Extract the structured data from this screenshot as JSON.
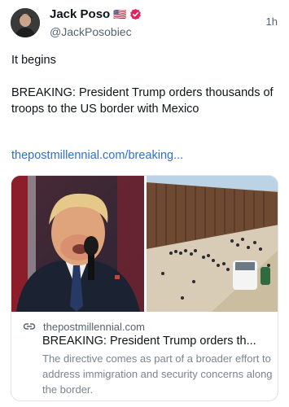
{
  "author": {
    "display_name": "Jack Poso",
    "flag": "🇺🇸",
    "handle": "@JackPosobiec",
    "verified": true,
    "avatar_icon": "person-avatar"
  },
  "timestamp": "1h",
  "post": {
    "line1": "It begins",
    "line2": "BREAKING: President Trump orders thousands of troops to the US border with Mexico",
    "link_text": "thepostmillennial.com/breaking...",
    "link_color": "#2f6fd1"
  },
  "card": {
    "domain": "thepostmillennial.com",
    "title": "BREAKING: President Trump orders th...",
    "description": "The directive comes as part of a broader effort to address immigration and security concerns along the border.",
    "link_icon": "link-icon",
    "images": [
      "speaker-at-microphone-photo",
      "border-wall-aerial-photo"
    ]
  },
  "colors": {
    "verified_badge": "#e0245e",
    "secondary_text": "#536471"
  }
}
